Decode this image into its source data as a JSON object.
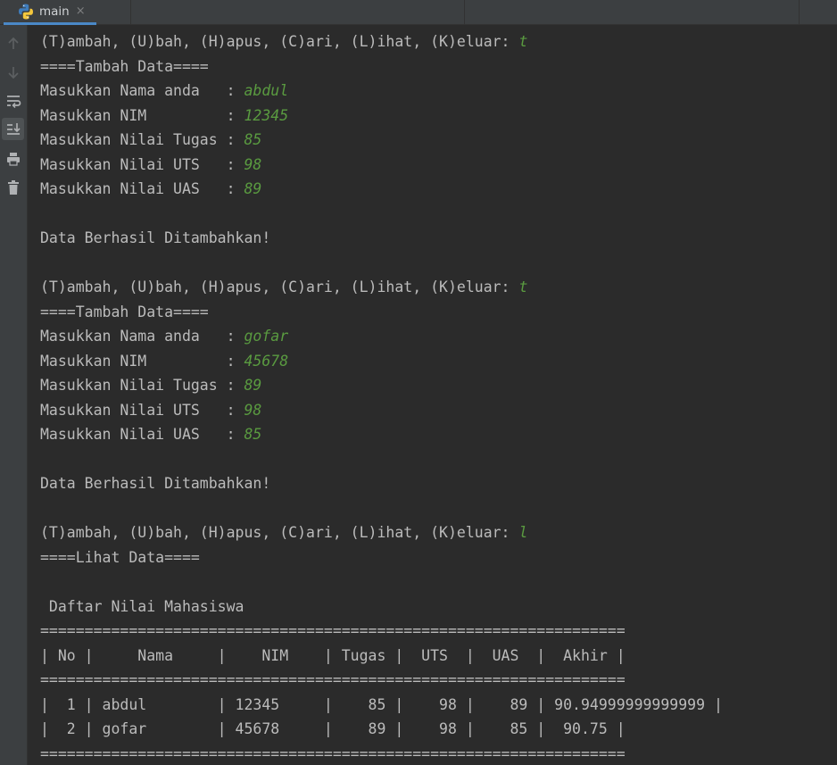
{
  "tab": {
    "label": "main",
    "close": "×",
    "icon": "python-icon"
  },
  "toolbar": [
    {
      "name": "up-arrow-icon",
      "enabled": false
    },
    {
      "name": "down-arrow-icon",
      "enabled": false
    },
    {
      "name": "soft-wrap-icon",
      "enabled": true
    },
    {
      "name": "scroll-to-end-icon",
      "enabled": true,
      "active": true
    },
    {
      "name": "print-icon",
      "enabled": true
    },
    {
      "name": "trash-icon",
      "enabled": true
    }
  ],
  "colors": {
    "background": "#2b2b2b",
    "panel": "#3c3f41",
    "text": "#bbbbbb",
    "user_input": "#5a9b40",
    "tab_underline": "#4a88c7"
  },
  "console": {
    "lines": [
      {
        "text": "(T)ambah, (U)bah, (H)apus, (C)ari, (L)ihat, (K)eluar: ",
        "input": "t"
      },
      {
        "text": "====Tambah Data===="
      },
      {
        "text": "Masukkan Nama anda   : ",
        "input": "abdul"
      },
      {
        "text": "Masukkan NIM         : ",
        "input": "12345"
      },
      {
        "text": "Masukkan Nilai Tugas : ",
        "input": "85"
      },
      {
        "text": "Masukkan Nilai UTS   : ",
        "input": "98"
      },
      {
        "text": "Masukkan Nilai UAS   : ",
        "input": "89"
      },
      {
        "text": ""
      },
      {
        "text": "Data Berhasil Ditambahkan!"
      },
      {
        "text": ""
      },
      {
        "text": "(T)ambah, (U)bah, (H)apus, (C)ari, (L)ihat, (K)eluar: ",
        "input": "t"
      },
      {
        "text": "====Tambah Data===="
      },
      {
        "text": "Masukkan Nama anda   : ",
        "input": "gofar"
      },
      {
        "text": "Masukkan NIM         : ",
        "input": "45678"
      },
      {
        "text": "Masukkan Nilai Tugas : ",
        "input": "89"
      },
      {
        "text": "Masukkan Nilai UTS   : ",
        "input": "98"
      },
      {
        "text": "Masukkan Nilai UAS   : ",
        "input": "85"
      },
      {
        "text": ""
      },
      {
        "text": "Data Berhasil Ditambahkan!"
      },
      {
        "text": ""
      },
      {
        "text": "(T)ambah, (U)bah, (H)apus, (C)ari, (L)ihat, (K)eluar: ",
        "input": "l"
      },
      {
        "text": "====Lihat Data===="
      },
      {
        "text": ""
      },
      {
        "text": " Daftar Nilai Mahasiswa"
      },
      {
        "text": "=================================================================="
      },
      {
        "text": "| No |     Nama     |    NIM    | Tugas |  UTS  |  UAS  |  Akhir |"
      },
      {
        "text": "=================================================================="
      },
      {
        "text": "|  1 | abdul        | 12345     |    85 |    98 |    89 | 90.94999999999999 |"
      },
      {
        "text": "|  2 | gofar        | 45678     |    89 |    98 |    85 |  90.75 |"
      },
      {
        "text": "=================================================================="
      }
    ]
  }
}
